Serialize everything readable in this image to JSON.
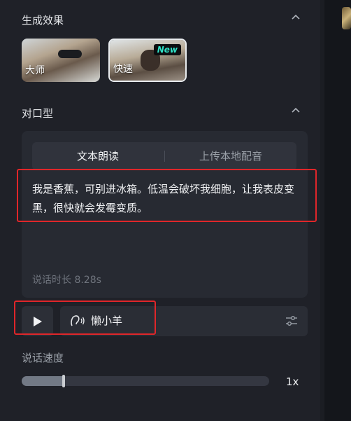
{
  "effect_section": {
    "title": "生成效果",
    "options": [
      {
        "label": "大师",
        "selected": false
      },
      {
        "label": "快速",
        "selected": true,
        "badge": "New"
      }
    ]
  },
  "lipsync_section": {
    "title": "对口型",
    "tabs": [
      {
        "label": "文本朗读",
        "active": true
      },
      {
        "label": "上传本地配音",
        "active": false
      }
    ],
    "script_text": "我是香蕉，可别进冰箱。低温会破坏我细胞，让我表皮变黑，很快就会发霉变质。",
    "duration_label": "说话时长 8.28s",
    "voice_name": "懒小羊",
    "icons": [
      "play-icon",
      "voice-wave-icon",
      "settings-sliders-icon",
      "chevron-up-icon"
    ]
  },
  "speed_section": {
    "label": "说话速度",
    "value_label": "1x",
    "level_percent": 17
  },
  "colors": {
    "panel_bg": "#1f2128",
    "card_bg": "#272a32",
    "highlight_red": "#e0262a",
    "badge_text": "#2fe3c8"
  }
}
